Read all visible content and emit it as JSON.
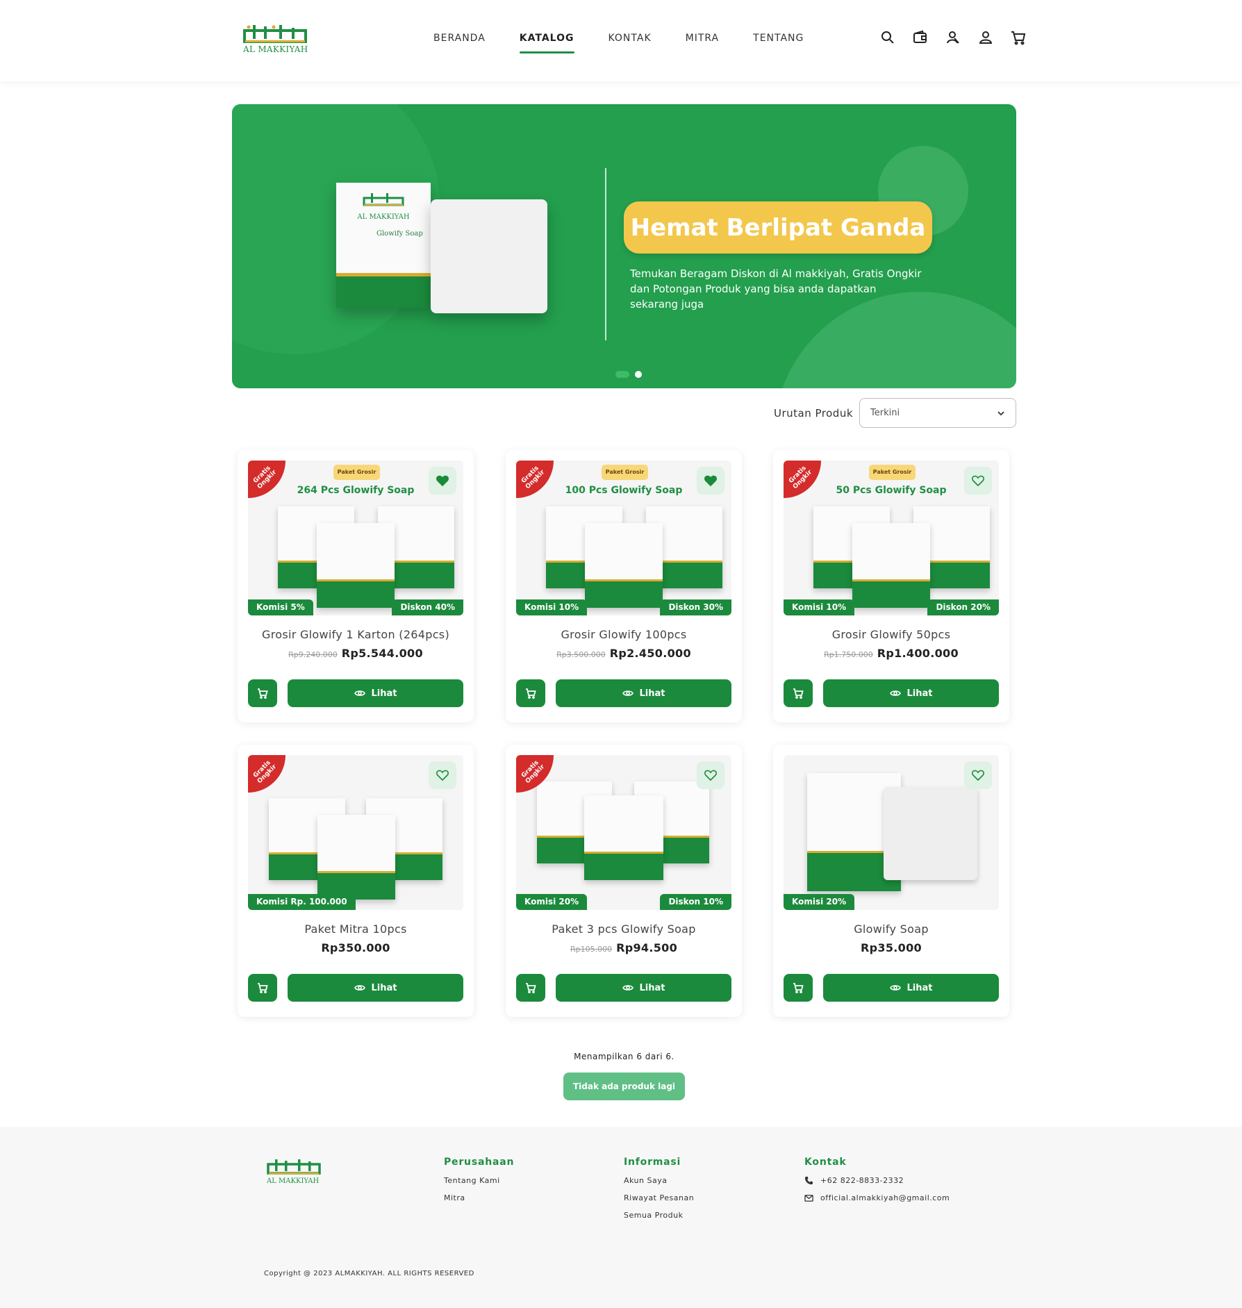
{
  "brand": {
    "arabic_logo": "المكية",
    "name": "AL MAKKIYAH"
  },
  "nav": [
    {
      "label": "BERANDA",
      "active": false
    },
    {
      "label": "KATALOG",
      "active": true
    },
    {
      "label": "KONTAK",
      "active": false
    },
    {
      "label": "MITRA",
      "active": false
    },
    {
      "label": "TENTANG",
      "active": false
    }
  ],
  "header_icons": [
    "search-icon",
    "wallet-icon",
    "affiliate-icon",
    "user-icon",
    "cart-icon"
  ],
  "banner": {
    "headline": "Hemat Berlipat Ganda",
    "description": "Temukan Beragam Diskon di Al makkiyah, Gratis Ongkir dan Potongan Produk yang bisa anda dapatkan sekarang juga",
    "box_brand": "AL MAKKIYAH",
    "box_product": "Glowify Soap",
    "slides": 2,
    "active_slide": 2
  },
  "sort": {
    "label": "Urutan Produk",
    "value": "Terkini"
  },
  "labels": {
    "view": "Lihat"
  },
  "products": [
    {
      "name": "Grosir Glowify 1 Karton (264pcs)",
      "old_price": "Rp9.240.000",
      "price": "Rp5.544.000",
      "komisi": "Komisi 5%",
      "diskon": "Diskon 40%",
      "ribbon": "Gratis Ongkir",
      "tag": "Paket Grosir",
      "image_title": "264 Pcs Glowify Soap",
      "favorited": true
    },
    {
      "name": "Grosir Glowify 100pcs",
      "old_price": "Rp3.500.000",
      "price": "Rp2.450.000",
      "komisi": "Komisi 10%",
      "diskon": "Diskon 30%",
      "ribbon": "Gratis Ongkir",
      "tag": "Paket Grosir",
      "image_title": "100 Pcs Glowify Soap",
      "favorited": true
    },
    {
      "name": "Grosir Glowify 50pcs",
      "old_price": "Rp1.750.000",
      "price": "Rp1.400.000",
      "komisi": "Komisi 10%",
      "diskon": "Diskon 20%",
      "ribbon": "Gratis Ongkir",
      "tag": "Paket Grosir",
      "image_title": "50 Pcs Glowify Soap",
      "favorited": false
    },
    {
      "name": "Paket Mitra 10pcs",
      "old_price": "",
      "price": "Rp350.000",
      "komisi": "Komisi Rp. 100.000",
      "diskon": "",
      "ribbon": "Gratis Ongkir",
      "tag": "",
      "image_title": "",
      "favorited": false
    },
    {
      "name": "Paket 3 pcs Glowify Soap",
      "old_price": "Rp105.000",
      "price": "Rp94.500",
      "komisi": "Komisi 20%",
      "diskon": "Diskon 10%",
      "ribbon": "Gratis Ongkir",
      "tag": "",
      "image_title": "",
      "favorited": false
    },
    {
      "name": "Glowify Soap",
      "old_price": "",
      "price": "Rp35.000",
      "komisi": "Komisi 20%",
      "diskon": "",
      "ribbon": "",
      "tag": "",
      "image_title": "",
      "favorited": false
    }
  ],
  "showing_text": "Menampilkan 6 dari 6.",
  "no_more_label": "Tidak ada produk lagi",
  "footer": {
    "perusahaan": {
      "title": "Perusahaan",
      "links": [
        "Tentang Kami",
        "Mitra"
      ]
    },
    "informasi": {
      "title": "Informasi",
      "links": [
        "Akun Saya",
        "Riwayat Pesanan",
        "Semua Produk"
      ]
    },
    "kontak": {
      "title": "Kontak",
      "phone": "+62 822-8833-2332",
      "email": "official.almakkiyah@gmail.com"
    },
    "copyright": "Copyright @ 2023 ALMAKKIYAH. ALL RIGHTS RESERVED"
  },
  "colors": {
    "primary": "#1b8a3c",
    "accent": "#f3c74c",
    "ribbon": "#d42b2b",
    "banner": "#239f4d"
  }
}
